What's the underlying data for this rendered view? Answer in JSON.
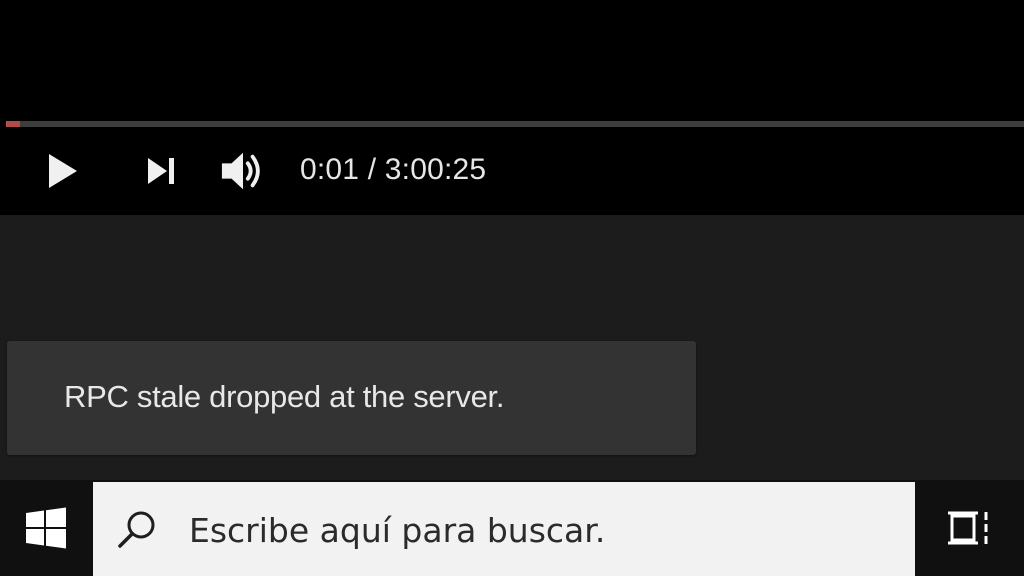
{
  "player": {
    "progress_fraction": 0.0001,
    "time_display": "0:01 / 3:00:25",
    "icons": {
      "play": "play-icon",
      "next": "skip-next-icon",
      "volume": "volume-icon"
    }
  },
  "toast": {
    "message": "RPC stale dropped at the server."
  },
  "taskbar": {
    "search_placeholder": "Escribe aquí para buscar.",
    "icons": {
      "start": "windows-logo-icon",
      "search": "search-icon",
      "taskview": "task-view-icon"
    }
  },
  "colors": {
    "video_bg": "#000000",
    "page_bg": "#1c1c1c",
    "toast_bg": "#333333",
    "taskbar_bg": "#101010",
    "search_bg": "#f2f2f2"
  }
}
